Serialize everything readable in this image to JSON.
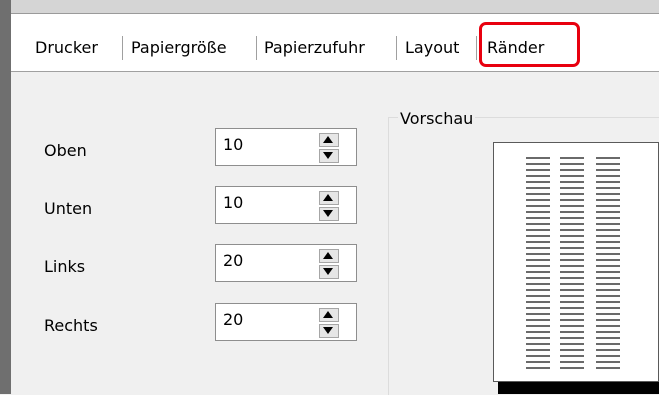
{
  "tabs": [
    {
      "label": "Drucker"
    },
    {
      "label": "Papiergröße"
    },
    {
      "label": "Papierzufuhr"
    },
    {
      "label": "Layout"
    },
    {
      "label": "Ränder",
      "selected": true
    }
  ],
  "highlight_color": "#e8000f",
  "margins": [
    {
      "label": "Oben",
      "value": "10"
    },
    {
      "label": "Unten",
      "value": "10"
    },
    {
      "label": "Links",
      "value": "20"
    },
    {
      "label": "Rechts",
      "value": "20"
    }
  ],
  "preview": {
    "title": "Vorschau"
  },
  "icons": {
    "spin_up": "triangle-up-icon",
    "spin_down": "triangle-down-icon"
  }
}
